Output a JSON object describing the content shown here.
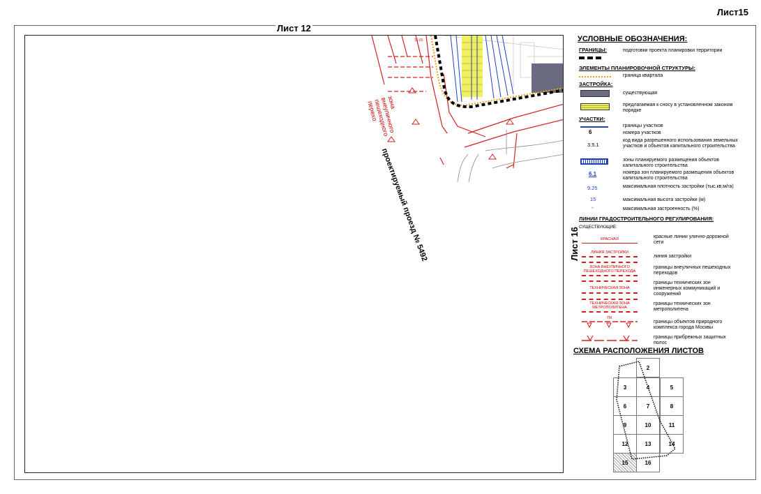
{
  "sheet_label": "Лист15",
  "neighbor_top": "Лист 12",
  "neighbor_right": "Лист 16",
  "map": {
    "road_label": "проектируемый проезд № 5492",
    "crossing_label_lines": [
      "зона",
      "внеуличного",
      "пешеходного",
      "перехо"
    ],
    "scale_mark": "15.65"
  },
  "legend": {
    "title": "УСЛОВНЫЕ ОБОЗНАЧЕНИЯ:",
    "boundaries_title": "ГРАНИЦЫ:",
    "boundaries_item": "подготовки проекта планировки территории",
    "elements_title": "ЭЛЕМЕНТЫ ПЛАНИРОВОЧНОЙ СТРУКТУРЫ:",
    "elements_item": "граница квартала",
    "building_title": "ЗАСТРОЙКА:",
    "building_existing": "существующая",
    "building_demolish": "предлагаемая к сносу в установленном законом порядке",
    "plots_title": "УЧАСТКИ:",
    "plots_boundaries": "границы участков",
    "plot_number_sym": "6",
    "plot_number": "номера участков",
    "use_code_sym": "3.5.1",
    "use_code": "код вида разрешенного использования земельных участков и объектов капитального строительства",
    "zones": "зоны планируемого размещения объектов капитального строительства",
    "zone_number_sym": "6.1",
    "zone_number": "номера зон планируемого размещения объектов капитального строительства",
    "density_sym": "9.25",
    "density": "максимальная плотность застройки (тыс.кв.м/га)",
    "height_sym": "15",
    "height": "максимальная высота застройки (м)",
    "coverage_sym": "-",
    "coverage": "максимальная застроенность (%)",
    "regulation_title": "ЛИНИИ ГРАДОСТРОИТЕЛЬНОГО РЕГУЛИРОВАНИЯ:",
    "existing": "СУЩЕСТВУЮЩИЕ:",
    "red_sym": "КРАСНАЯ",
    "red_lines": "красные линии улично-дорожной сети",
    "building_line_sym": "ЛИНИЯ ЗАСТРОЙКИ",
    "building_line": "линия застройки",
    "crossing_sym": "ЗОНА ВНЕУЛИЧНОГО ПЕШЕХОДНОГО ПЕРЕХОДА",
    "crossing": "границы внеуличных пешеходных переходов",
    "tech_sym": "ТЕХНИЧЕСКАЯ ЗОНА",
    "tech": "границы технических зон инженерных коммуникаций и сооружений",
    "metro_sym": "ТЕХНИЧЕСКАЯ ЗОНА МЕТРОПОЛИТЕНА",
    "metro": "границы технических зон метрополитена",
    "nature_sym": "ПК",
    "nature": "границы объектов природного комплекса города Москвы",
    "coastal": "границы прибрежных защитных полос"
  },
  "scheme": {
    "title": "СХЕМА РАСПОЛОЖЕНИЯ ЛИСТОВ",
    "cells": [
      "2",
      "3",
      "4",
      "5",
      "6",
      "7",
      "8",
      "9",
      "10",
      "11",
      "12",
      "13",
      "14",
      "15",
      "16"
    ],
    "current": "15"
  },
  "colors": {
    "red": "#d42020",
    "orange": "#f0a020",
    "blue": "#2040c0",
    "yellow": "#f0f060",
    "existing": "#6a6a80"
  }
}
